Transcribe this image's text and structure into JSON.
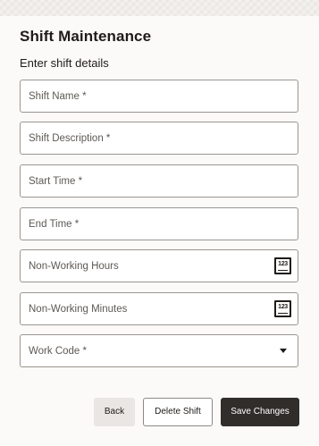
{
  "header": {
    "title": "Shift Maintenance",
    "subtitle": "Enter shift details"
  },
  "fields": [
    {
      "label": "Shift Name *",
      "value": ""
    },
    {
      "label": "Shift Description *",
      "value": ""
    },
    {
      "label": "Start Time *",
      "value": ""
    },
    {
      "label": "End Time *",
      "value": ""
    },
    {
      "label": "Non-Working Hours",
      "value": "",
      "icon": "number-input-icon",
      "icon_text": "123"
    },
    {
      "label": "Non-Working Minutes",
      "value": "",
      "icon": "number-input-icon",
      "icon_text": "123"
    },
    {
      "label": "Work Code *",
      "value": "",
      "icon": "chevron-down-icon"
    }
  ],
  "actions": {
    "back_label": "Back",
    "delete_label": "Delete Shift",
    "save_label": "Save Changes"
  },
  "colors": {
    "primary_button": "#312d2a",
    "panel_background": "#fbfaf9",
    "field_border": "#9b958f"
  }
}
